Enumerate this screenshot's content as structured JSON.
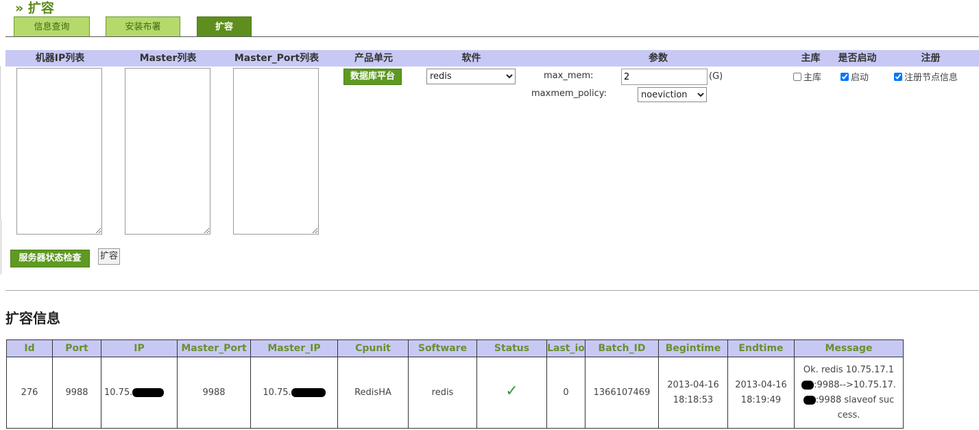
{
  "page": {
    "title": "» 扩容"
  },
  "tabs": [
    {
      "label": "信息查询",
      "active": false
    },
    {
      "label": "安装布署",
      "active": false
    },
    {
      "label": "扩容",
      "active": true
    }
  ],
  "form": {
    "headers": {
      "ip_list": "机器IP列表",
      "master_list": "Master列表",
      "master_port_list": "Master_Port列表",
      "product_unit": "产品单元",
      "software": "软件",
      "params": "参数",
      "master": "主库",
      "enabled": "是否启动",
      "register": "注册"
    },
    "product_unit_value": "数据库平台",
    "software_value": "redis",
    "max_mem_label": "max_mem:",
    "max_mem_value": "2",
    "max_mem_unit": "(G)",
    "maxmem_policy_label": "maxmem_policy:",
    "maxmem_policy_value": "noeviction",
    "checkbox_master": {
      "label": "主库",
      "checked": false
    },
    "checkbox_enabled": {
      "label": "启动",
      "checked": true
    },
    "checkbox_register": {
      "label": "注册节点信息",
      "checked": true
    },
    "check_button": "服务器状态检查",
    "expand_button": "扩容"
  },
  "info": {
    "title": "扩容信息",
    "columns": [
      "Id",
      "Port",
      "IP",
      "Master_Port",
      "Master_IP",
      "Cpunit",
      "Software",
      "Status",
      "Last_io",
      "Batch_ID",
      "Begintime",
      "Endtime",
      "Message"
    ],
    "rows": [
      {
        "id": "276",
        "port": "9988",
        "ip_prefix": "10.75.",
        "master_port": "9988",
        "master_ip_prefix": "10.75.",
        "cpunit": "RedisHA",
        "software": "redis",
        "status_icon": "check-icon",
        "last_io": "0",
        "batch_id": "1366107469",
        "begintime": "2013-04-16 18:18:53",
        "endtime": "2013-04-16 18:19:49",
        "message_1": "Ok. redis 10.75.17.1",
        "message_2": ":9988-->10.75.17.",
        "message_3": ":9988 slaveof suc",
        "message_4": "cess."
      }
    ]
  },
  "colors": {
    "accent_green": "#5e9a22",
    "header_lavender": "#c7c9f4",
    "tab_inactive": "#b5d96a"
  }
}
